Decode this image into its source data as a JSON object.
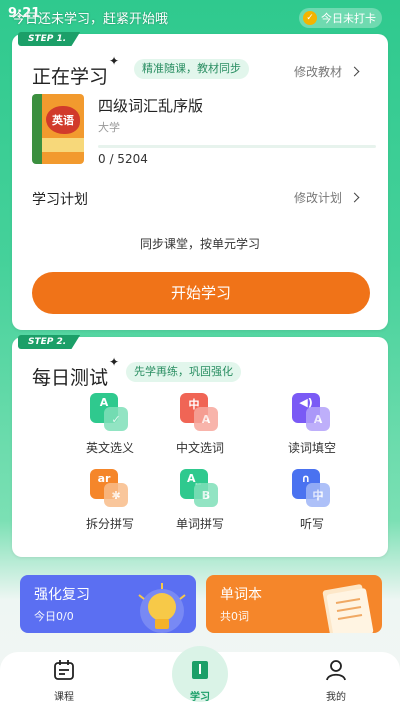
{
  "status": {
    "time": "9:21"
  },
  "banner": {
    "text": "今日还未学习，赶紧开始哦",
    "checkin": "今日未打卡"
  },
  "study": {
    "step": "STEP 1.",
    "title": "正在学习",
    "tag": "精准随课，教材同步",
    "change_book": "修改教材",
    "book_cover_text": "英语",
    "book_title": "四级词汇乱序版",
    "book_sub": "大学",
    "progress_text": "0 /  5204",
    "progress_fraction": 0,
    "plan_label": "学习计划",
    "change_plan": "修改计划",
    "plan_desc": "同步课堂，按单元学习",
    "start_button": "开始学习"
  },
  "daily": {
    "step": "STEP 2.",
    "title": "每日测试",
    "tag": "先学再练，巩固强化",
    "tests": [
      {
        "label": "英文选义",
        "icon": "A",
        "icon2": "✓",
        "color": "#2fc98e",
        "color2": "#7fe0b9"
      },
      {
        "label": "中文选词",
        "icon": "中",
        "icon2": "A",
        "color": "#f06555",
        "color2": "#f7a79d"
      },
      {
        "label": "读词填空",
        "icon": "◀)",
        "icon2": "A",
        "color": "#7a5af5",
        "color2": "#b3a2fa"
      },
      {
        "label": "拆分拼写",
        "icon": "ar",
        "icon2": "✱",
        "color": "#f5862a",
        "color2": "#f9bd8a"
      },
      {
        "label": "单词拼写",
        "icon": "A_",
        "icon2": "B",
        "color": "#2fc98e",
        "color2": "#7fe0b9"
      },
      {
        "label": "听写",
        "icon": "∩",
        "icon2": "中",
        "color": "#4a72f0",
        "color2": "#9fb6f7"
      }
    ]
  },
  "promo": {
    "review_title": "强化复习",
    "review_sub": "今日0/0",
    "wordbook_title": "单词本",
    "wordbook_sub": "共0词",
    "review_color": "#5b6ff2",
    "wordbook_color": "#f5862a"
  },
  "tabs": {
    "course": "课程",
    "study": "学习",
    "mine": "我的"
  }
}
